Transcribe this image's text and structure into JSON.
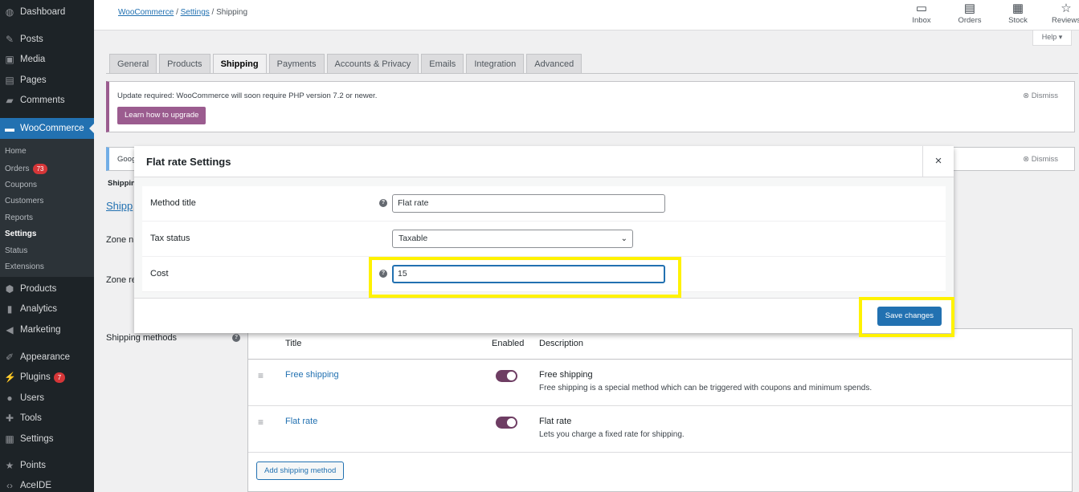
{
  "sidebar": {
    "top_items": [
      {
        "label": "Dashboard",
        "icon": "dashboard-icon"
      },
      {
        "label": "Posts",
        "icon": "pin-icon"
      },
      {
        "label": "Media",
        "icon": "media-icon"
      },
      {
        "label": "Pages",
        "icon": "pages-icon"
      },
      {
        "label": "Comments",
        "icon": "comment-icon"
      }
    ],
    "woocommerce_label": "WooCommerce",
    "woo_sub": [
      {
        "label": "Home"
      },
      {
        "label": "Orders",
        "badge": "73"
      },
      {
        "label": "Coupons"
      },
      {
        "label": "Customers"
      },
      {
        "label": "Reports"
      },
      {
        "label": "Settings"
      },
      {
        "label": "Status"
      },
      {
        "label": "Extensions"
      }
    ],
    "bottom_items": [
      {
        "label": "Products"
      },
      {
        "label": "Analytics"
      },
      {
        "label": "Marketing"
      },
      {
        "label": "Appearance"
      },
      {
        "label": "Plugins",
        "badge": "7"
      },
      {
        "label": "Users"
      },
      {
        "label": "Tools"
      },
      {
        "label": "Settings"
      },
      {
        "label": "Points"
      },
      {
        "label": "AceIDE"
      }
    ]
  },
  "breadcrumb": {
    "woocommerce": "WooCommerce",
    "sep1": "/",
    "settings": "Settings",
    "sep2": "/",
    "current": "Shipping"
  },
  "top_icons": [
    {
      "label": "Inbox",
      "icon": "inbox-icon"
    },
    {
      "label": "Orders",
      "icon": "orders-icon"
    },
    {
      "label": "Stock",
      "icon": "stock-icon"
    },
    {
      "label": "Reviews",
      "icon": "star-icon"
    }
  ],
  "help_label": "Help ▾",
  "tabs": [
    {
      "label": "General"
    },
    {
      "label": "Products"
    },
    {
      "label": "Shipping",
      "active": true
    },
    {
      "label": "Payments"
    },
    {
      "label": "Accounts & Privacy"
    },
    {
      "label": "Emails"
    },
    {
      "label": "Integration"
    },
    {
      "label": "Advanced"
    }
  ],
  "notice1": {
    "text": "Update required: WooCommerce will soon require PHP version 7.2 or newer.",
    "button": "Learn how to upgrade",
    "dismiss": "Dismiss"
  },
  "notice2": {
    "text": "Goog",
    "dismiss": "Dismiss"
  },
  "background": {
    "shipping_crumb": "Shippin",
    "shipping_link": "Shipp",
    "zone_name": "Zone n",
    "zone_regions": "Zone re",
    "shipping_methods_label": "Shipping methods",
    "columns": {
      "title": "Title",
      "enabled": "Enabled",
      "description": "Description"
    },
    "methods": [
      {
        "title": "Free shipping",
        "desc_title": "Free shipping",
        "desc": "Free shipping is a special method which can be triggered with coupons and minimum spends."
      },
      {
        "title": "Flat rate",
        "desc_title": "Flat rate",
        "desc": "Lets you charge a fixed rate for shipping."
      }
    ],
    "add_button": "Add shipping method"
  },
  "modal": {
    "title": "Flat rate Settings",
    "close": "×",
    "fields": {
      "method_title_label": "Method title",
      "method_title_value": "Flat rate",
      "tax_status_label": "Tax status",
      "tax_status_value": "Taxable",
      "cost_label": "Cost",
      "cost_value": "15"
    },
    "save_button": "Save changes"
  },
  "colors": {
    "accent": "#2271b1",
    "woo_purple": "#9b5c8f",
    "highlight": "#fff200",
    "sidebar": "#1d2327"
  }
}
